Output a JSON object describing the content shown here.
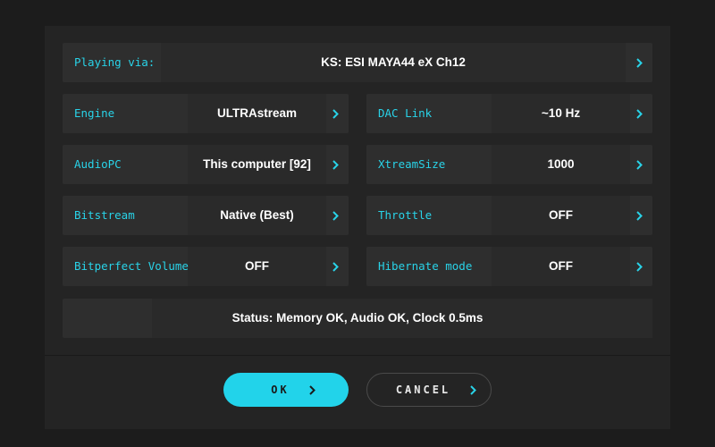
{
  "colors": {
    "accent": "#29d3e8",
    "background": "#1c1c1c",
    "panel": "#242424",
    "row": "#2e2e2e",
    "text": "#ffffff"
  },
  "playing": {
    "label": "Playing via:",
    "value": "KS: ESI MAYA44 eX Ch12"
  },
  "settings_left": [
    {
      "label": "Engine",
      "value": "ULTRAstream"
    },
    {
      "label": "AudioPC",
      "value": "This computer [92]"
    },
    {
      "label": "Bitstream",
      "value": "Native (Best)"
    },
    {
      "label": "Bitperfect Volume",
      "value": "OFF"
    }
  ],
  "settings_right": [
    {
      "label": "DAC Link",
      "value": "~10 Hz"
    },
    {
      "label": "XtreamSize",
      "value": "1000"
    },
    {
      "label": "Throttle",
      "value": "OFF"
    },
    {
      "label": "Hibernate mode",
      "value": "OFF"
    }
  ],
  "status": {
    "text": "Status: Memory OK, Audio OK, Clock 0.5ms"
  },
  "buttons": {
    "ok_label": "OK",
    "cancel_label": "CANCEL"
  },
  "icons": {
    "chevron": "chevron-right-icon"
  }
}
